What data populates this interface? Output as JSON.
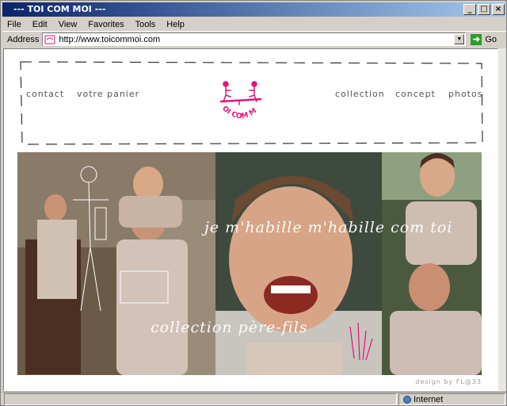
{
  "window": {
    "title": "--- TOI COM MOI ---",
    "min": "_",
    "max": "□",
    "close": "×"
  },
  "menu": [
    "File",
    "Edit",
    "View",
    "Favorites",
    "Tools",
    "Help"
  ],
  "address": {
    "label": "Address",
    "url": "http://www.toicommoi.com",
    "go_label": "Go"
  },
  "status": {
    "zone": "Internet"
  },
  "site": {
    "nav_left": [
      "contact",
      "votre panier"
    ],
    "nav_right": [
      "collection",
      "concept",
      "photos"
    ],
    "logo_text": "TOI COM MOI",
    "overlay_1": "je m'habille m'habille com toi",
    "overlay_2": "collection père-fils",
    "credit": "design by FL@33"
  },
  "colors": {
    "brand": "#e0157a",
    "title_bar": "#0a246a"
  }
}
